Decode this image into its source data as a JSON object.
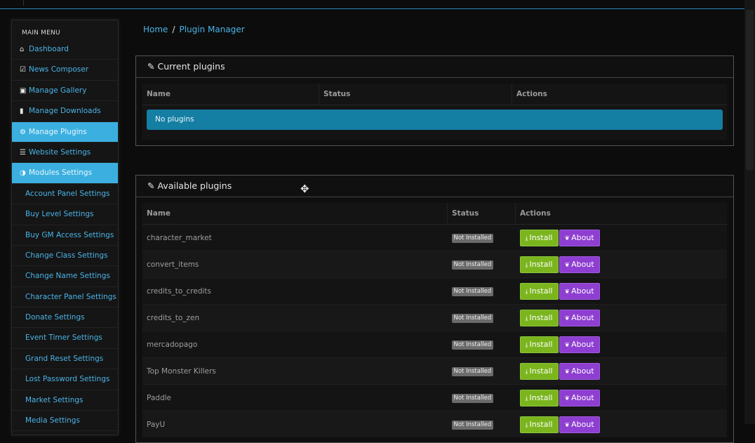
{
  "sidebar": {
    "title": "MAIN MENU",
    "items": [
      {
        "label": "Dashboard",
        "icon": "home-icon",
        "glyph": "⌂"
      },
      {
        "label": "News Composer",
        "icon": "edit-icon",
        "glyph": "☑"
      },
      {
        "label": "Manage Gallery",
        "icon": "image-icon",
        "glyph": "▣"
      },
      {
        "label": "Manage Downloads",
        "icon": "file-icon",
        "glyph": "▮"
      },
      {
        "label": "Manage Plugins",
        "icon": "gear-icon",
        "glyph": "⚙"
      },
      {
        "label": "Website Settings",
        "icon": "list-icon",
        "glyph": "☰"
      },
      {
        "label": "Modules Settings",
        "icon": "contrast-icon",
        "glyph": "◑"
      }
    ],
    "sub_items": [
      "Account Panel Settings",
      "Buy Level Settings",
      "Buy GM Access Settings",
      "Change Class Settings",
      "Change Name Settings",
      "Character Panel Settings",
      "Donate Settings",
      "Event Timer Settings",
      "Grand Reset Settings",
      "Lost Password Settings",
      "Market Settings",
      "Media Settings"
    ]
  },
  "breadcrumb": {
    "home": "Home",
    "separator": "/",
    "current": "Plugin Manager"
  },
  "current": {
    "title": "Current plugins",
    "columns": [
      "Name",
      "Status",
      "Actions"
    ],
    "empty_text": "No plugins"
  },
  "available": {
    "title": "Available plugins",
    "columns": [
      "Name",
      "Status",
      "Actions"
    ],
    "rows": [
      {
        "name": "character_market",
        "status": "Not Installed"
      },
      {
        "name": "convert_items",
        "status": "Not Installed"
      },
      {
        "name": "credits_to_credits",
        "status": "Not Installed"
      },
      {
        "name": "credits_to_zen",
        "status": "Not Installed"
      },
      {
        "name": "mercadopago",
        "status": "Not Installed"
      },
      {
        "name": "Top Monster Killers",
        "status": "Not Installed"
      },
      {
        "name": "Paddle",
        "status": "Not Installed"
      },
      {
        "name": "PayU",
        "status": "Not Installed"
      }
    ],
    "install_label": "Install",
    "about_label": "About"
  },
  "colors": {
    "accent": "#3bb0e0",
    "link": "#4ab3e6",
    "install": "#7ab51d",
    "about": "#8e3ed0",
    "info": "#157ea3"
  }
}
